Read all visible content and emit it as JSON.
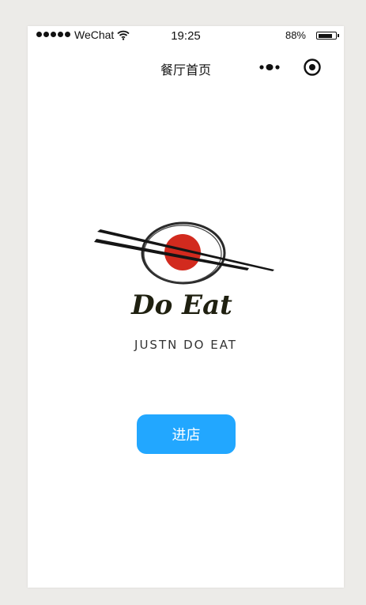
{
  "status_bar": {
    "carrier": "WeChat",
    "time": "19:25",
    "battery_percent": "88%",
    "battery_level": 0.88,
    "signal_icon": "signal-dots-icon",
    "wifi_icon": "wifi-icon"
  },
  "nav": {
    "title": "餐厅首页",
    "more_icon": "more-dots-icon",
    "capsule_icon": "target-circle-icon"
  },
  "logo": {
    "brand_name": "Do Eat",
    "tagline": "JUSTN DO EAT",
    "icon": "chopsticks-bowl-logo",
    "accent_color": "#d22a1e"
  },
  "enter_button": {
    "label": "进店",
    "color": "#22a7ff"
  }
}
